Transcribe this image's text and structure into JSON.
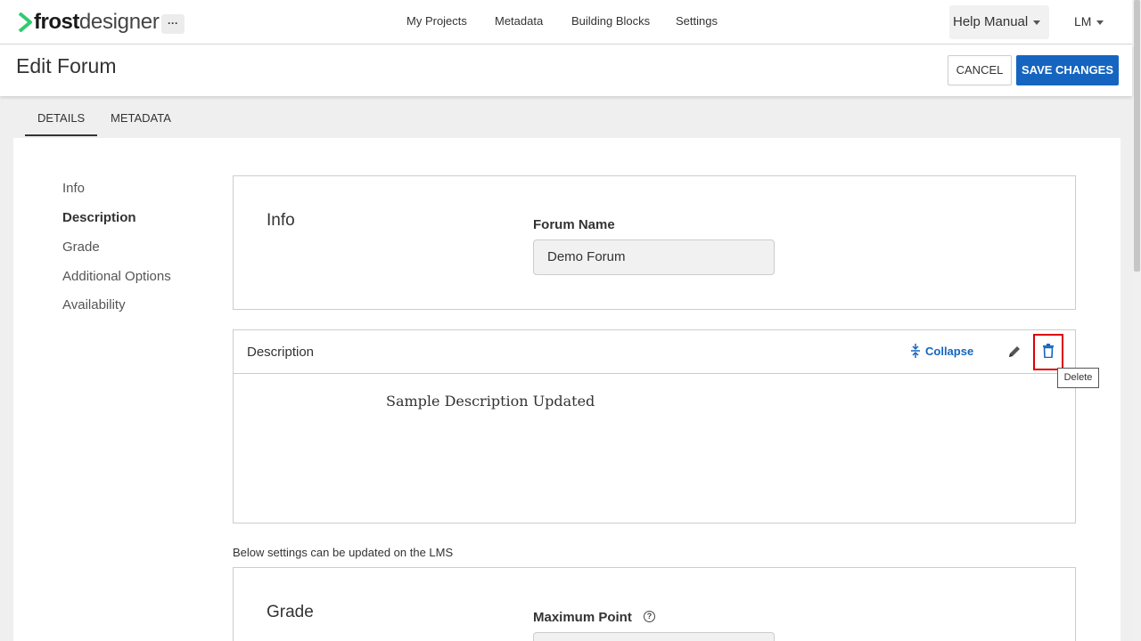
{
  "brand": {
    "bold": "frost",
    "light": "designer",
    "accent": "#2ecc71"
  },
  "nav": {
    "more": "···",
    "links": [
      "My Projects",
      "Metadata",
      "Building Blocks",
      "Settings"
    ],
    "help": "Help Manual",
    "user": "LM"
  },
  "header": {
    "title": "Edit Forum",
    "cancel": "CANCEL",
    "save": "SAVE CHANGES",
    "primary_color": "#1565c0"
  },
  "tabs": [
    "DETAILS",
    "METADATA"
  ],
  "sidebar": {
    "items": [
      "Info",
      "Description",
      "Grade",
      "Additional Options",
      "Availability"
    ],
    "active": "Description"
  },
  "info": {
    "title": "Info",
    "forum_name_label": "Forum Name",
    "forum_name_value": "Demo Forum"
  },
  "description": {
    "title": "Description",
    "collapse": "Collapse",
    "tooltip": "Delete",
    "body": "Sample Description Updated",
    "icons": [
      "collapse-icon",
      "pencil-icon",
      "trash-icon"
    ]
  },
  "lms_note": "Below settings can be updated on the LMS",
  "grade": {
    "title": "Grade",
    "max_label": "Maximum Point",
    "help": "?"
  }
}
